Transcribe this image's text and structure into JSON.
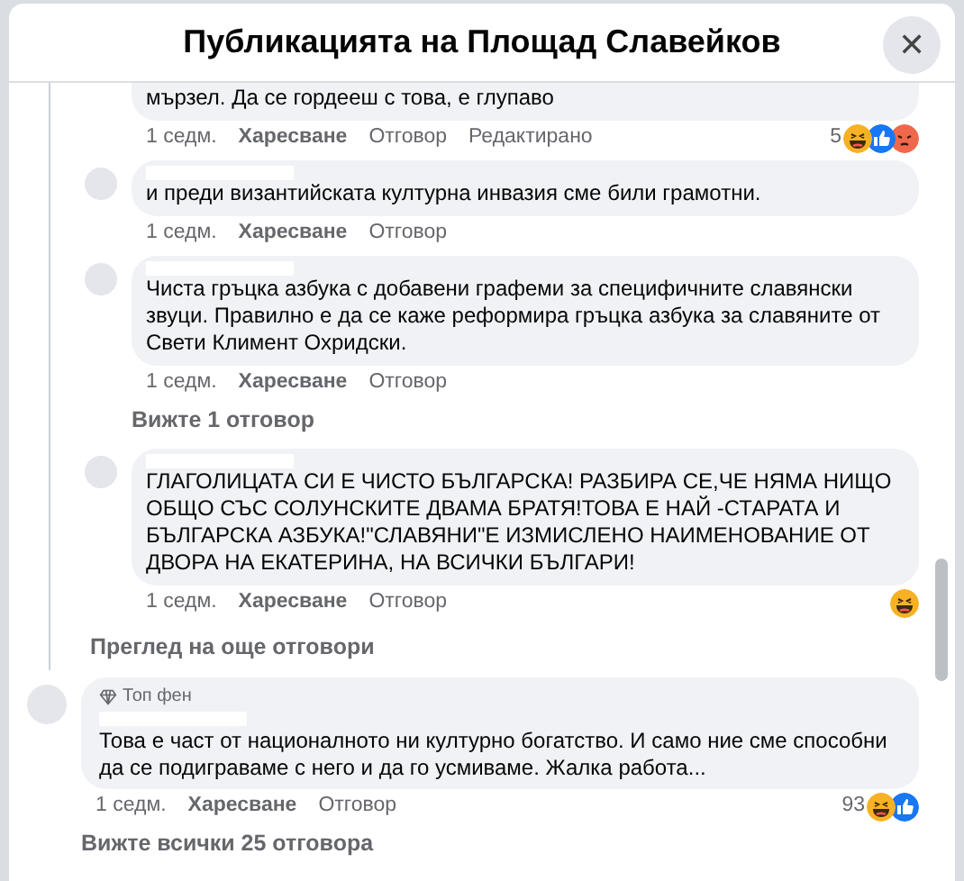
{
  "dialog": {
    "title": "Публикацията на Площад Славейков",
    "close_label": "✕"
  },
  "replies": [
    {
      "text": "мързел. Да се гордееш с това, е глупаво",
      "cut_top": true,
      "time": "1 седм.",
      "like": "Харесване",
      "reply": "Отговор",
      "edited": "Редактирано",
      "reaction_count": "5",
      "reactions": [
        {
          "kind": "laugh"
        },
        {
          "kind": "like"
        },
        {
          "kind": "angry"
        }
      ]
    },
    {
      "text": "и преди византийската културна инвазия сме били грамотни.",
      "cut_top": false,
      "time": "1 седм.",
      "like": "Харесване",
      "reply": "Отговор"
    },
    {
      "text": "Чиста гръцка азбука с добавени графеми за специфичните славянски звуци. Правилно е да се каже реформира гръцка азбука за славяните от Свети Климент Охридски.",
      "cut_top": false,
      "time": "1 седм.",
      "like": "Харесване",
      "reply": "Отговор",
      "more": "Вижте 1 отговор"
    },
    {
      "text": "ГЛАГОЛИЦАТА СИ Е ЧИСТО БЪЛГАРСКА! РАЗБИРА СЕ,ЧЕ НЯМА НИЩО ОБЩО СЪС СОЛУНСКИТЕ ДВАМА БРАТЯ!ТОВА Е НАЙ -СТАРАТА И БЪЛГАРСКА АЗБУКА!\"СЛАВЯНИ\"Е ИЗМИСЛЕНО НАИМЕНОВАНИЕ ОТ ДВОРА НА ЕКАТЕРИНА, НА ВСИЧКИ БЪЛГАРИ!",
      "cut_top": false,
      "time": "1 седм.",
      "like": "Харесване",
      "reply": "Отговор",
      "reactions": [
        {
          "kind": "laugh"
        }
      ]
    }
  ],
  "more_replies": "Преглед на още отговори",
  "comment": {
    "badge": "Топ фен",
    "text": "Това е част от националното ни културно богатство. И само ние сме способни да се подиграваме с него и да го усмиваме. Жалка работа...",
    "time": "1 седм.",
    "like": "Харесване",
    "reply": "Отговор",
    "reaction_count": "93",
    "reactions": [
      {
        "kind": "laugh"
      },
      {
        "kind": "like"
      }
    ],
    "more": "Вижте всички 25 отговора"
  }
}
